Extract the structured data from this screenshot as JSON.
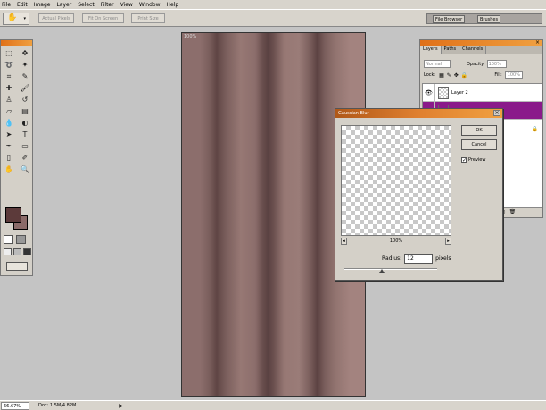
{
  "menu": [
    "File",
    "Edit",
    "Image",
    "Layer",
    "Select",
    "Filter",
    "View",
    "Window",
    "Help"
  ],
  "options_bar": {
    "buttons": [
      "Actual Pixels",
      "Fit On Screen",
      "Print Size"
    ],
    "palette_well": [
      "File Browser",
      "Brushes"
    ]
  },
  "layers_panel": {
    "tabs": [
      "Layers",
      "Paths",
      "Channels"
    ],
    "blend_mode": "Normal",
    "opacity_label": "Opacity:",
    "opacity": "100%",
    "lock_label": "Lock:",
    "fill_label": "Fill:",
    "fill": "100%",
    "layers": [
      {
        "name": "Layer 2",
        "selected": false
      },
      {
        "name": "",
        "selected": true
      }
    ]
  },
  "dialog": {
    "title": "Gaussian Blur",
    "ok_label": "OK",
    "cancel_label": "Cancel",
    "preview_label": "Preview",
    "preview_checked": true,
    "zoom_percent": "100%",
    "radius_label": "Radius:",
    "radius_value": "12",
    "radius_unit": "pixels",
    "radius_slider_fraction": 0.4
  },
  "canvas": {
    "doc_label": "100%"
  },
  "statusbar": {
    "zoom": "66.67%",
    "doc": "Doc: 1.5M/4.82M"
  },
  "colors": {
    "foreground": "#5c3a3a",
    "background": "#8a6a68",
    "selected_layer": "#8a1a8a"
  }
}
